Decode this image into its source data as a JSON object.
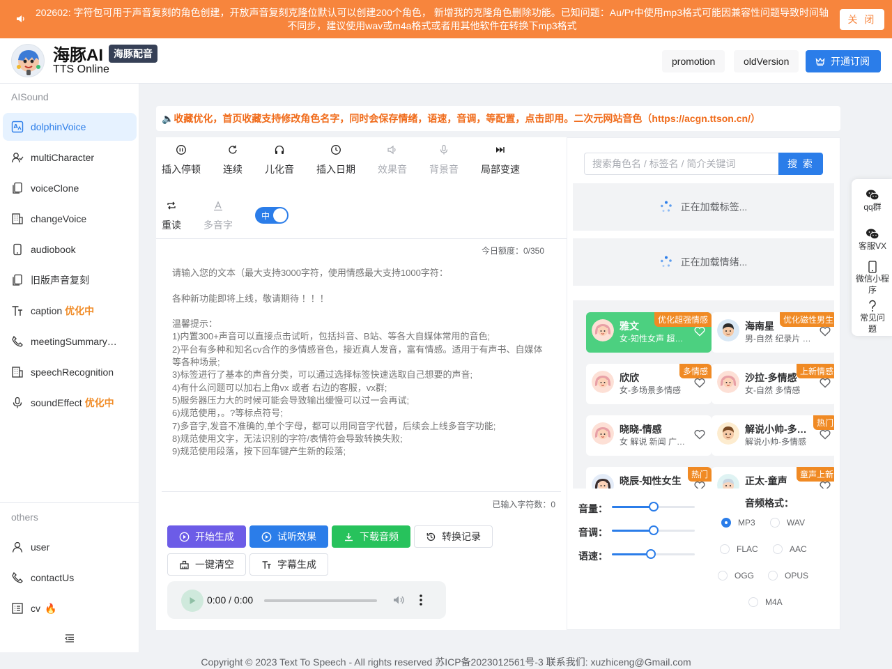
{
  "notice": {
    "text": "202602: 字符包可用于声音复刻的角色创建，开放声音复刻克隆位默认可以创建200个角色， 新增我的克隆角色删除功能。已知问题：Au/Pr中使用mp3格式可能因兼容性问题导致时间轴不同步，建议使用wav或m4a格式或者用其他软件在转换下mp3格式",
    "close_label": "关 闭"
  },
  "header": {
    "brand": "海豚AI",
    "brand_tag": "海豚配音",
    "subtitle": "TTS Online",
    "promotion": "promotion",
    "old_version": "oldVersion",
    "subscribe": "开通订阅"
  },
  "sidebar": {
    "group1": "AISound",
    "items": [
      {
        "label": "dolphinVoice",
        "icon": "tts-icon"
      },
      {
        "label": "multiCharacter",
        "icon": "users-icon"
      },
      {
        "label": "voiceClone",
        "icon": "copy-icon"
      },
      {
        "label": "changeVoice",
        "icon": "building-icon"
      },
      {
        "label": "audiobook",
        "icon": "phone-icon"
      },
      {
        "label": "旧版声音复刻",
        "icon": "copy-icon"
      },
      {
        "label": "caption",
        "badge": "优化中",
        "icon": "text-icon"
      },
      {
        "label": "meetingSummary…",
        "icon": "phone-call-icon"
      },
      {
        "label": "speechRecognition",
        "icon": "building-icon"
      },
      {
        "label": "soundEffect",
        "badge": "优化中",
        "icon": "mic-icon"
      }
    ],
    "group2": "others",
    "others": [
      {
        "label": "user",
        "icon": "user-icon"
      },
      {
        "label": "contactUs",
        "icon": "phone-call-icon"
      },
      {
        "label": "cv",
        "badge": "🔥",
        "icon": "list-icon"
      }
    ]
  },
  "announcement": "🔈收藏优化，首页收藏支持修改角色名字，同时会保存情绪，语速，音调，等配置，点击即用。二次元网站音色（https://acgn.ttson.cn/）",
  "toolbar": {
    "items": [
      {
        "label": "插入停顿",
        "icon": "pause-icon",
        "disabled": false
      },
      {
        "label": "连续",
        "icon": "refresh-icon",
        "disabled": false
      },
      {
        "label": "儿化音",
        "icon": "headphone-icon",
        "disabled": false
      },
      {
        "label": "插入日期",
        "icon": "clock-icon",
        "disabled": false
      },
      {
        "label": "效果音",
        "icon": "speaker-icon",
        "disabled": true
      },
      {
        "label": "背景音",
        "icon": "mic-icon",
        "disabled": true
      },
      {
        "label": "局部变速",
        "icon": "fast-forward-icon",
        "disabled": false
      }
    ],
    "row2": [
      {
        "label": "重读",
        "icon": "repeat-icon",
        "disabled": false
      },
      {
        "label": "多音字",
        "icon": "font-icon",
        "disabled": true
      }
    ],
    "switch_label": "中"
  },
  "editor": {
    "quota": "今日额度：0/350",
    "placeholder": "请输入您的文本（最大支持3000字符，使用情感最大支持1000字符：\n\n各种新功能即将上线，敬请期待 ！！！\n\n温馨提示：\n1)内置300+声音可以直接点击试听，包括抖音、B站、等各大自媒体常用的音色;\n2)平台有多种和知名cv合作的多情感音色，接近真人发音，富有情感。适用于有声书、自媒体等各种场景;\n3)标签进行了基本的声音分类，可以通过选择标签快速选取自己想要的声音;\n4)有什么问题可以加右上角vx 或者 右边的客服，vx群;\n5)服务器压力大的时候可能会导致输出缓慢可以过一会再试;\n6)规范使用，。?等标点符号;\n7)多音字,发音不准确的,单个字母，都可以用同音字代替，后续会上线多音字功能;\n8)规范使用文字，无法识别的字符/表情符会导致转换失败;\n9)规范使用段落，按下回车键产生新的段落;",
    "char_count": "已输入字符数：0"
  },
  "actions": {
    "generate": "开始生成",
    "preview": "试听效果",
    "download": "下载音频",
    "history": "转换记录",
    "clear": "一键清空",
    "subtitle": "字幕生成"
  },
  "audio": {
    "time": "0:00 / 0:00"
  },
  "search": {
    "placeholder": "搜索角色名 / 标签名 / 简介关键词",
    "button": "搜 索"
  },
  "loading": {
    "tags": "正在加载标签...",
    "emotions": "正在加载情绪..."
  },
  "voices": [
    {
      "name": "雅文",
      "desc": "女-知性女声 超…",
      "tag": "优化超强情感",
      "avatar": "female",
      "selected": true
    },
    {
      "name": "海南星",
      "desc": "男-自然 纪录片 …",
      "tag": "优化磁性男生",
      "avatar": "male",
      "selected": false
    },
    {
      "name": "欣欣",
      "desc": "女-多场景多情感",
      "tag": "多情感",
      "avatar": "female",
      "selected": false
    },
    {
      "name": "沙拉-多情感",
      "desc": "女-自然 多情感",
      "tag": "上新情感",
      "avatar": "female",
      "selected": false
    },
    {
      "name": "晓晓-情感",
      "desc": "女 解说 新闻 广…",
      "tag": "",
      "avatar": "female",
      "selected": false
    },
    {
      "name": "解说小帅-多…",
      "desc": "解说小帅-多情感",
      "tag": "热门",
      "avatar": "male",
      "selected": false
    },
    {
      "name": "晓辰-知性女生",
      "desc": "",
      "tag": "热门",
      "avatar": "female",
      "selected": false
    },
    {
      "name": "正太-童声",
      "desc": "",
      "tag": "童声上新",
      "avatar": "child",
      "selected": false
    }
  ],
  "sliders": [
    {
      "label": "音量：",
      "value": 0.5
    },
    {
      "label": "音调：",
      "value": 0.5
    },
    {
      "label": "语速：",
      "value": 0.47
    }
  ],
  "formats": {
    "title": "音频格式：",
    "options": [
      "MP3",
      "WAV",
      "FLAC",
      "AAC",
      "OGG",
      "OPUS",
      "M4A"
    ],
    "selected": "MP3"
  },
  "float": [
    {
      "label": "qq群",
      "icon": "wechat-icon"
    },
    {
      "label": "客服VX",
      "icon": "wechat-icon"
    },
    {
      "label": "微信小程序",
      "icon": "mobile-icon"
    },
    {
      "label": "常见问题",
      "icon": "question-icon"
    }
  ],
  "footer": "Copyright © 2023 Text To Speech - All rights reserved  苏ICP备2023012561号-3   联系我们: xuzhiceng@Gmail.com",
  "colors": {
    "primary": "#2b7de9",
    "notice": "#f7853d",
    "accent": "#f08a24",
    "selected": "#4cd080",
    "purple": "#6c5ce7",
    "green": "#27c25c"
  }
}
